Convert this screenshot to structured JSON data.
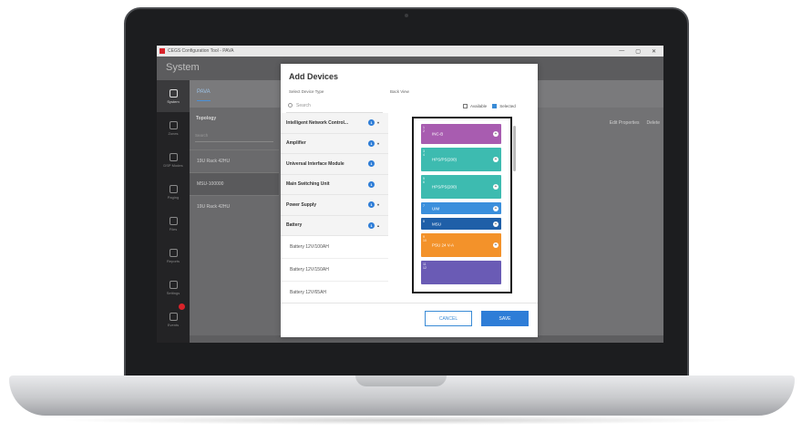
{
  "window": {
    "title": "CEGS Configuration Tool - PAVA",
    "controls": [
      "—",
      "▢",
      "✕"
    ]
  },
  "header": {
    "title": "System"
  },
  "rail": [
    {
      "label": "System",
      "icon": "system-icon",
      "active": true
    },
    {
      "label": "Zones",
      "icon": "home-icon",
      "active": false
    },
    {
      "label": "DSP Modes",
      "icon": "dsp-icon",
      "active": false
    },
    {
      "label": "Paging",
      "icon": "paging-icon",
      "active": false
    },
    {
      "label": "Files",
      "icon": "file-icon",
      "active": false
    },
    {
      "label": "Reports",
      "icon": "report-icon",
      "active": false
    },
    {
      "label": "Settings",
      "icon": "gear-icon",
      "active": false
    },
    {
      "label": "Events",
      "icon": "alert-icon",
      "active": false
    }
  ],
  "content": {
    "tab": "PAVA",
    "topology": {
      "heading": "Topology",
      "search_placeholder": "Search",
      "rows": [
        "19U Rack 42HU",
        "MSU-100000",
        "19U Rack 42HU"
      ]
    },
    "actions": {
      "edit": "Edit Properties",
      "delete": "Delete"
    }
  },
  "dialog": {
    "title": "Add Devices",
    "select_label": "Select Device Type",
    "back_label": "Back View",
    "search_placeholder": "Search",
    "categories": [
      {
        "name": "Intelligent Network Control...",
        "count": "1",
        "chevron": "▾"
      },
      {
        "name": "Amplifier",
        "count": "1",
        "chevron": "▾"
      },
      {
        "name": "Universal Interface Module",
        "count": "1",
        "chevron": ""
      },
      {
        "name": "Main Switching Unit",
        "count": "1",
        "chevron": ""
      },
      {
        "name": "Power Supply",
        "count": "1",
        "chevron": "▾"
      },
      {
        "name": "Battery",
        "count": "1",
        "chevron": "▴"
      }
    ],
    "battery_items": [
      "Battery 12V/100AH",
      "Battery 12V/150AH",
      "Battery 12V/65AH"
    ],
    "legend": {
      "available": "Available",
      "selected": "Selected"
    },
    "slots": [
      {
        "num": "1\n2",
        "label": "INC-B",
        "color": "#a85cb0",
        "height": 22
      },
      {
        "num": "3\n4",
        "label": "HPS/PS(200)",
        "color": "#3dbbb0",
        "height": 26
      },
      {
        "num": "5\n6",
        "label": "HPS/PS(200)",
        "color": "#3dbbb0",
        "height": 26
      },
      {
        "num": "7",
        "label": "UIM",
        "color": "#3a8fdc",
        "height": 13
      },
      {
        "num": "8",
        "label": "MSU",
        "color": "#1f5fa8",
        "height": 13
      },
      {
        "num": "9\n10",
        "label": "PSU 24 V-A",
        "color": "#f3922a",
        "height": 26
      },
      {
        "num": "11\n12",
        "label": "",
        "color": "#6a5bb5",
        "height": 26
      }
    ],
    "cancel": "CANCEL",
    "save": "SAVE"
  }
}
